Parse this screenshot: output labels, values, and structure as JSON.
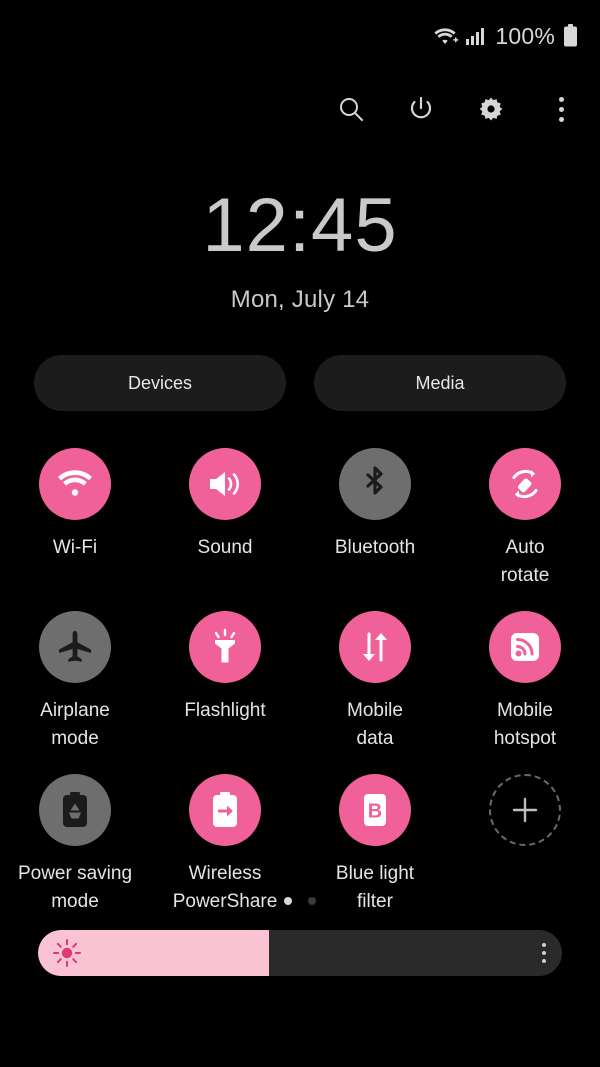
{
  "theme": {
    "background": "#000000",
    "accent_on": "#F0619A",
    "toggle_off": "#6E6E6E",
    "slider_fill": "#F9C3D4",
    "slider_track": "#2A2A2A",
    "text": "#E4E4E4"
  },
  "status_bar": {
    "wifi_icon": "wifi-icon",
    "signal_icon": "cellular-signal-icon",
    "battery_percent": "100%",
    "battery_icon": "battery-full-icon"
  },
  "toolbar": {
    "search_icon": "search-icon",
    "power_icon": "power-icon",
    "settings_icon": "gear-icon",
    "more_icon": "more-vertical-icon"
  },
  "clock": {
    "time": "12:45",
    "date": "Mon, July 14"
  },
  "shortcuts": {
    "devices_label": "Devices",
    "media_label": "Media"
  },
  "quick_settings": {
    "tiles": [
      {
        "label": "Wi-Fi",
        "icon": "wifi-icon",
        "state": "on"
      },
      {
        "label": "Sound",
        "icon": "sound-icon",
        "state": "on"
      },
      {
        "label": "Bluetooth",
        "icon": "bluetooth-icon",
        "state": "off"
      },
      {
        "label": "Auto\nrotate",
        "icon": "auto-rotate-icon",
        "state": "on"
      },
      {
        "label": "Airplane\nmode",
        "icon": "airplane-icon",
        "state": "off"
      },
      {
        "label": "Flashlight",
        "icon": "flashlight-icon",
        "state": "on"
      },
      {
        "label": "Mobile\ndata",
        "icon": "mobile-data-icon",
        "state": "on"
      },
      {
        "label": "Mobile\nhotspot",
        "icon": "hotspot-icon",
        "state": "on"
      },
      {
        "label": "Power saving\nmode",
        "icon": "power-saving-icon",
        "state": "off"
      },
      {
        "label": "Wireless\nPowerShare",
        "icon": "powershare-icon",
        "state": "on"
      },
      {
        "label": "Blue light\nfilter",
        "icon": "blue-light-filter-icon",
        "state": "on"
      }
    ],
    "add_button_icon": "plus-icon"
  },
  "pager": {
    "pages": 2,
    "active_page": 1
  },
  "brightness": {
    "value_percent": 44,
    "icon": "brightness-sun-icon",
    "menu_icon": "more-vertical-icon"
  }
}
